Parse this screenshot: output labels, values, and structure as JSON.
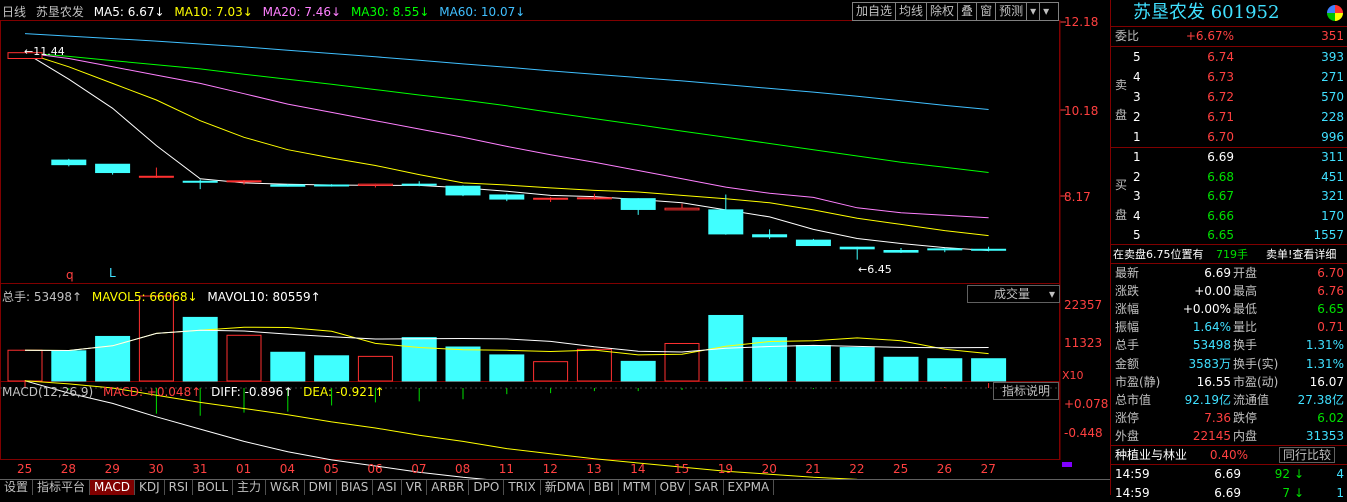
{
  "header": {
    "period": "日线",
    "stock_name": "苏垦农发",
    "ma5": "MA5: 6.67↓",
    "ma10": "MA10: 7.03↓",
    "ma20": "MA20: 7.46↓",
    "ma30": "MA30: 8.55↓",
    "ma60": "MA60: 10.07↓"
  },
  "toolbar": [
    "加自选",
    "均线",
    "除权",
    "叠",
    "窗",
    "预测",
    "▾",
    "▾"
  ],
  "price_axis": [
    "12.18",
    "10.18",
    "8.17"
  ],
  "vol_axis": [
    "22357",
    "11323",
    "X10"
  ],
  "macd_axis": [
    "+0.078",
    "-0.448"
  ],
  "annotations": {
    "high_label": "←11.44",
    "low_label": "←6.45",
    "q": "q",
    "l": "L"
  },
  "volume_legend": {
    "total": "总手: 53498↑",
    "mavol5": "MAVOL5: 66068↓",
    "mavol10": "MAVOL10: 80559↑",
    "selector": "成交量",
    "selector_arrow": "▾"
  },
  "macd_legend": {
    "name": "MACD(12,26,9)",
    "macd": "MACD: +0.048↑",
    "diff": "DIFF: -0.896↑",
    "dea": "DEA: -0.921↑",
    "explain": "指标说明"
  },
  "dates": [
    "25",
    "28",
    "29",
    "30",
    "31",
    "01",
    "04",
    "05",
    "06",
    "07",
    "08",
    "11",
    "12",
    "13",
    "14",
    "15",
    "19",
    "20",
    "21",
    "22",
    "25",
    "26",
    "27"
  ],
  "tabs": [
    "设置",
    "指标平台",
    "MACD",
    "KDJ",
    "RSI",
    "BOLL",
    "主力",
    "W&R",
    "DMI",
    "BIAS",
    "ASI",
    "VR",
    "ARBR",
    "DPO",
    "TRIX",
    "新DMA",
    "BBI",
    "MTM",
    "OBV",
    "SAR",
    "EXPMA"
  ],
  "active_tab": "MACD",
  "chart_data": {
    "type": "candlestick",
    "categories": [
      "25",
      "28",
      "29",
      "30",
      "31",
      "01",
      "04",
      "05",
      "06",
      "07",
      "08",
      "11",
      "12",
      "13",
      "14",
      "15",
      "19",
      "20",
      "21",
      "22",
      "25",
      "26",
      "27"
    ],
    "candles": [
      [
        11.3,
        11.44,
        11.3,
        11.44
      ],
      [
        8.85,
        8.88,
        8.7,
        8.74
      ],
      [
        8.75,
        8.75,
        8.5,
        8.55
      ],
      [
        8.46,
        8.67,
        8.42,
        8.46
      ],
      [
        8.34,
        8.38,
        8.15,
        8.33
      ],
      [
        8.35,
        8.37,
        8.26,
        8.35
      ],
      [
        8.25,
        8.27,
        8.21,
        8.22
      ],
      [
        8.25,
        8.27,
        8.21,
        8.23
      ],
      [
        8.24,
        8.28,
        8.19,
        8.27
      ],
      [
        8.27,
        8.34,
        8.22,
        8.26
      ],
      [
        8.22,
        8.24,
        7.98,
        8.01
      ],
      [
        8.01,
        8.04,
        7.86,
        7.91
      ],
      [
        7.92,
        7.96,
        7.84,
        7.93
      ],
      [
        7.92,
        8.04,
        7.89,
        7.94
      ],
      [
        7.92,
        7.93,
        7.53,
        7.66
      ],
      [
        7.65,
        7.8,
        7.66,
        7.69
      ],
      [
        7.65,
        8.02,
        7.05,
        7.07
      ],
      [
        7.05,
        7.18,
        6.95,
        7.0
      ],
      [
        6.92,
        6.95,
        6.78,
        6.79
      ],
      [
        6.75,
        6.76,
        6.45,
        6.71
      ],
      [
        6.67,
        6.73,
        6.61,
        6.63
      ],
      [
        6.71,
        6.73,
        6.63,
        6.69
      ],
      [
        6.7,
        6.76,
        6.65,
        6.69
      ]
    ],
    "ma": {
      "MA5": [
        11.44,
        10.8,
        10.1,
        9.2,
        8.4,
        8.3,
        8.27,
        8.25,
        8.24,
        8.24,
        8.18,
        8.1,
        8.0,
        7.97,
        7.9,
        7.82,
        7.65,
        7.48,
        7.18,
        6.96,
        6.84,
        6.74,
        6.67
      ],
      "MA10": [
        11.44,
        11.1,
        10.7,
        10.3,
        9.8,
        9.4,
        9.1,
        8.9,
        8.72,
        8.5,
        8.3,
        8.25,
        8.18,
        8.12,
        8.08,
        8.0,
        7.92,
        7.82,
        7.65,
        7.45,
        7.3,
        7.15,
        7.03
      ],
      "MA20": [
        11.44,
        11.3,
        11.1,
        10.9,
        10.7,
        10.45,
        10.2,
        10.0,
        9.8,
        9.6,
        9.4,
        9.18,
        8.98,
        8.8,
        8.6,
        8.4,
        8.2,
        8.05,
        7.95,
        7.7,
        7.58,
        7.52,
        7.46
      ],
      "MA30": [
        11.44,
        11.35,
        11.25,
        11.15,
        11.05,
        10.92,
        10.8,
        10.68,
        10.55,
        10.42,
        10.3,
        10.16,
        10.0,
        9.85,
        9.7,
        9.55,
        9.4,
        9.25,
        9.1,
        8.95,
        8.8,
        8.68,
        8.55
      ],
      "MA60": [
        11.9,
        11.84,
        11.78,
        11.72,
        11.65,
        11.58,
        11.5,
        11.42,
        11.34,
        11.26,
        11.17,
        11.09,
        11.0,
        10.92,
        10.84,
        10.76,
        10.67,
        10.58,
        10.49,
        10.39,
        10.28,
        10.17,
        10.07
      ]
    },
    "volume": [
      10500,
      10300,
      15200,
      29000,
      21700,
      15600,
      9800,
      8600,
      8400,
      14800,
      11600,
      8900,
      6600,
      10800,
      6700,
      12800,
      22357,
      14800,
      12100,
      11400,
      8100,
      7600,
      7600
    ],
    "macd_bars": [
      0.078,
      -0.02,
      -0.01,
      -0.25,
      -0.27,
      -0.24,
      -0.23,
      -0.17,
      -0.14,
      -0.13,
      -0.11,
      -0.06,
      -0.05,
      -0.03,
      -0.03,
      -0.02,
      -0.01,
      -0.01,
      -0.01,
      0.0,
      -0.01,
      0.01,
      0.048
    ],
    "diff": [
      0.07,
      -0.05,
      -0.15,
      -0.28,
      -0.4,
      -0.52,
      -0.62,
      -0.7,
      -0.76,
      -0.82,
      -0.87,
      -0.91,
      -0.94,
      -0.96,
      -0.98,
      -0.99,
      -1.0,
      -1.0,
      -0.99,
      -0.97,
      -0.94,
      -0.91,
      -0.896
    ],
    "dea": [
      0.07,
      0.04,
      0.0,
      -0.07,
      -0.14,
      -0.2,
      -0.26,
      -0.33,
      -0.39,
      -0.46,
      -0.52,
      -0.59,
      -0.64,
      -0.69,
      -0.73,
      -0.77,
      -0.81,
      -0.84,
      -0.87,
      -0.89,
      -0.9,
      -0.91,
      -0.921
    ],
    "ylim_price": [
      6.2,
      12.18
    ],
    "colors": {
      "up": "#ff3030",
      "down": "#40ffff",
      "ma5": "#ffffff",
      "ma10": "#ffff00",
      "ma20": "#ff80ff",
      "ma30": "#00ff00",
      "ma60": "#40c0ff"
    }
  },
  "panel": {
    "title": "苏垦农发 601952",
    "weibi": {
      "label": "委比",
      "pct": "+6.67%",
      "val": "351"
    },
    "sell_side_label": [
      "卖",
      "盘"
    ],
    "buy_side_label": [
      "买",
      "盘"
    ],
    "sell": [
      {
        "lvl": "5",
        "price": "6.74",
        "vol": "393"
      },
      {
        "lvl": "4",
        "price": "6.73",
        "vol": "271"
      },
      {
        "lvl": "3",
        "price": "6.72",
        "vol": "570"
      },
      {
        "lvl": "2",
        "price": "6.71",
        "vol": "228"
      },
      {
        "lvl": "1",
        "price": "6.70",
        "vol": "996"
      }
    ],
    "buy": [
      {
        "lvl": "1",
        "price": "6.69",
        "vol": "311"
      },
      {
        "lvl": "2",
        "price": "6.68",
        "vol": "451"
      },
      {
        "lvl": "3",
        "price": "6.67",
        "vol": "321"
      },
      {
        "lvl": "4",
        "price": "6.66",
        "vol": "170"
      },
      {
        "lvl": "5",
        "price": "6.65",
        "vol": "1557"
      }
    ],
    "notice": {
      "text": "在卖盘6.75位置有",
      "count": "719手",
      "link": "卖单!查看详细"
    },
    "stats": [
      {
        "l1": "最新",
        "v1": "6.69",
        "l2": "开盘",
        "v2": "6.70"
      },
      {
        "l1": "涨跌",
        "v1": "+0.00",
        "l2": "最高",
        "v2": "6.76"
      },
      {
        "l1": "涨幅",
        "v1": "+0.00%",
        "l2": "最低",
        "v2": "6.65"
      },
      {
        "l1": "振幅",
        "v1": "1.64%",
        "l2": "量比",
        "v2": "0.71"
      },
      {
        "l1": "总手",
        "v1": "53498",
        "l2": "换手",
        "v2": "1.31%"
      },
      {
        "l1": "金额",
        "v1": "3583万",
        "l2": "换手(实)",
        "v2": "1.31%"
      },
      {
        "l1": "市盈(静)",
        "v1": "16.55",
        "l2": "市盈(动)",
        "v2": "16.07"
      },
      {
        "l1": "总市值",
        "v1": "92.19亿",
        "l2": "流通值",
        "v2": "27.38亿"
      },
      {
        "l1": "涨停",
        "v1": "7.36",
        "l2": "跌停",
        "v2": "6.02"
      },
      {
        "l1": "外盘",
        "v1": "22145",
        "l2": "内盘",
        "v2": "31353"
      }
    ],
    "industry": {
      "name": "种植业与林业",
      "pct": "0.40%",
      "compare": "同行比较"
    },
    "ticks": [
      {
        "time": "14:59",
        "price": "6.69",
        "vol": "92",
        "arrow": "↓",
        "n": "4"
      },
      {
        "time": "14:59",
        "price": "6.69",
        "vol": "7",
        "arrow": "↓",
        "n": "1"
      }
    ]
  }
}
